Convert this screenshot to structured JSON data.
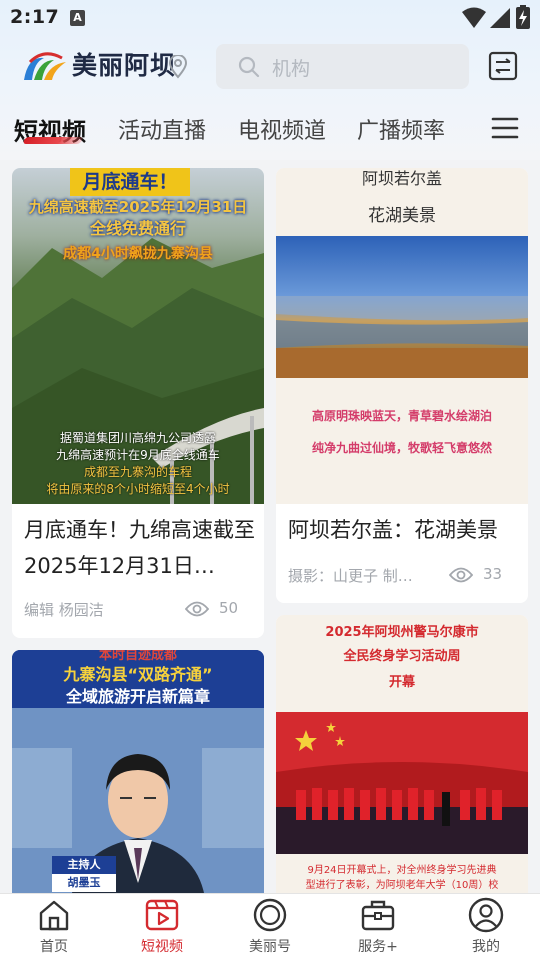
{
  "status_bar": {
    "time": "2:17",
    "notification_badge": "A"
  },
  "header": {
    "app_name": "美丽阿坝",
    "search": {
      "placeholder": "机构"
    }
  },
  "tabs": [
    {
      "label": "短视频",
      "active": true
    },
    {
      "label": "活动直播",
      "active": false
    },
    {
      "label": "电视频道",
      "active": false
    },
    {
      "label": "广播频率",
      "active": false
    }
  ],
  "feed": [
    {
      "title": "月底通车！九绵高速截至2025年12月31日…",
      "meta": "编辑 杨园洁",
      "views": "50",
      "thumb": {
        "banner": "月底通车！",
        "headline": "九绵高速截至2025年12月31日",
        "headline2": "全线免费通行",
        "sub": "成都4小时飙拢九寨沟县",
        "caption1": "据蜀道集团川高绵九公司透露",
        "caption2": "九绵高速预计在9月底全线通车",
        "caption3": "成都至九寨沟的车程",
        "caption4": "将由原来的8个小时缩短至4个小时"
      }
    },
    {
      "title": "阿坝若尔盖：花湖美景",
      "meta": "摄影：山更子 制…",
      "views": "33",
      "thumb": {
        "line1": "阿坝若尔盖",
        "line2": "花湖美景",
        "poem1": "高原明珠映蓝天，青草碧水绘湖泊",
        "poem2": "纯净九曲过仙境，牧歌轻飞意悠然"
      }
    },
    {
      "thumb": {
        "top": "本时自迹成都",
        "headline": "九寨沟县“双路齐通”",
        "headline2": "全域旅游开启新篇章",
        "tag": "主持人",
        "name": "胡墨玉"
      }
    },
    {
      "thumb": {
        "line1": "2025年阿坝州警马尔康市",
        "line2": "全民终身学习活动周",
        "line3": "开幕",
        "foot1": "9月24日开幕式上，对全州终身学习先进典",
        "foot2": "型进行了表彰，为阿坝老年大学（10周）校"
      }
    }
  ],
  "bottom_nav": [
    {
      "label": "首页",
      "icon": "home-icon",
      "active": false
    },
    {
      "label": "短视频",
      "icon": "video-icon",
      "active": true
    },
    {
      "label": "美丽号",
      "icon": "circle-icon",
      "active": false
    },
    {
      "label": "服务+",
      "icon": "briefcase-icon",
      "active": false
    },
    {
      "label": "我的",
      "icon": "user-icon",
      "active": false
    }
  ],
  "colors": {
    "accent": "#d42a2f",
    "logo_blue": "#2b7fd6",
    "logo_green": "#3aa23a",
    "logo_orange": "#f2a51b"
  }
}
